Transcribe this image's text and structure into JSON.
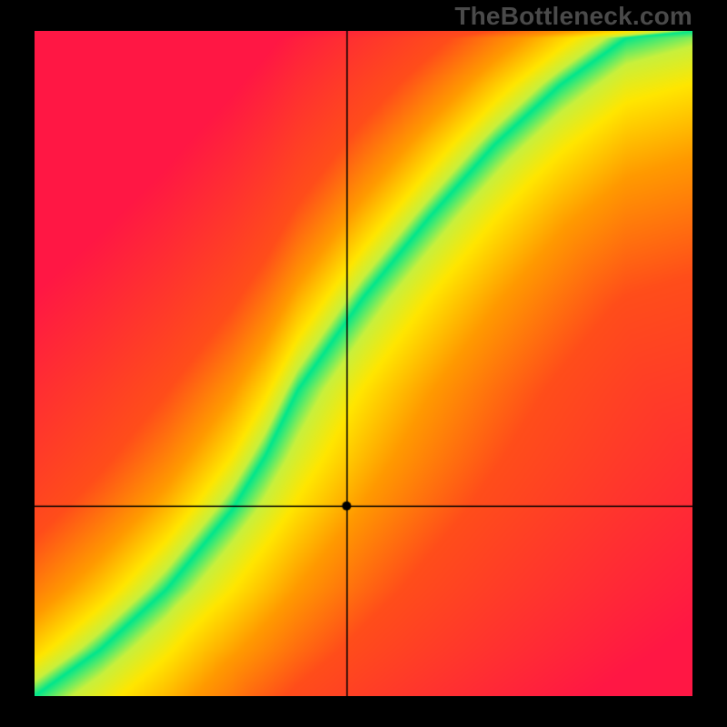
{
  "watermark": "TheBottleneck.com",
  "chart_data": {
    "type": "heatmap",
    "title": "",
    "xlabel": "",
    "ylabel": "",
    "xlim": [
      0,
      1
    ],
    "ylim": [
      0,
      1
    ],
    "grid": false,
    "legend": false,
    "crosshair": {
      "x": 0.475,
      "y": 0.285
    },
    "marker": {
      "x": 0.475,
      "y": 0.285
    },
    "optimal_curve": [
      {
        "x": 0.0,
        "y": 0.0
      },
      {
        "x": 0.1,
        "y": 0.07
      },
      {
        "x": 0.2,
        "y": 0.16
      },
      {
        "x": 0.3,
        "y": 0.28
      },
      {
        "x": 0.35,
        "y": 0.36
      },
      {
        "x": 0.4,
        "y": 0.46
      },
      {
        "x": 0.5,
        "y": 0.6
      },
      {
        "x": 0.6,
        "y": 0.72
      },
      {
        "x": 0.7,
        "y": 0.83
      },
      {
        "x": 0.8,
        "y": 0.92
      },
      {
        "x": 0.9,
        "y": 0.99
      },
      {
        "x": 1.0,
        "y": 1.0
      }
    ],
    "color_scale": [
      {
        "distance": 0.0,
        "color": "#00e68c"
      },
      {
        "distance": 0.05,
        "color": "#c8f03c"
      },
      {
        "distance": 0.12,
        "color": "#ffe600"
      },
      {
        "distance": 0.25,
        "color": "#ff9a00"
      },
      {
        "distance": 0.45,
        "color": "#ff4d1a"
      },
      {
        "distance": 1.0,
        "color": "#ff1744"
      }
    ],
    "description": "Heatmap over unit square. A narrow green band runs along the optimal_curve (diagonal, slightly S-shaped). Color transitions outward from green → yellow → orange → red with distance from the band. A black crosshair (full-width horizontal + full-height vertical lines) intersects at the marker point with a small black dot."
  }
}
